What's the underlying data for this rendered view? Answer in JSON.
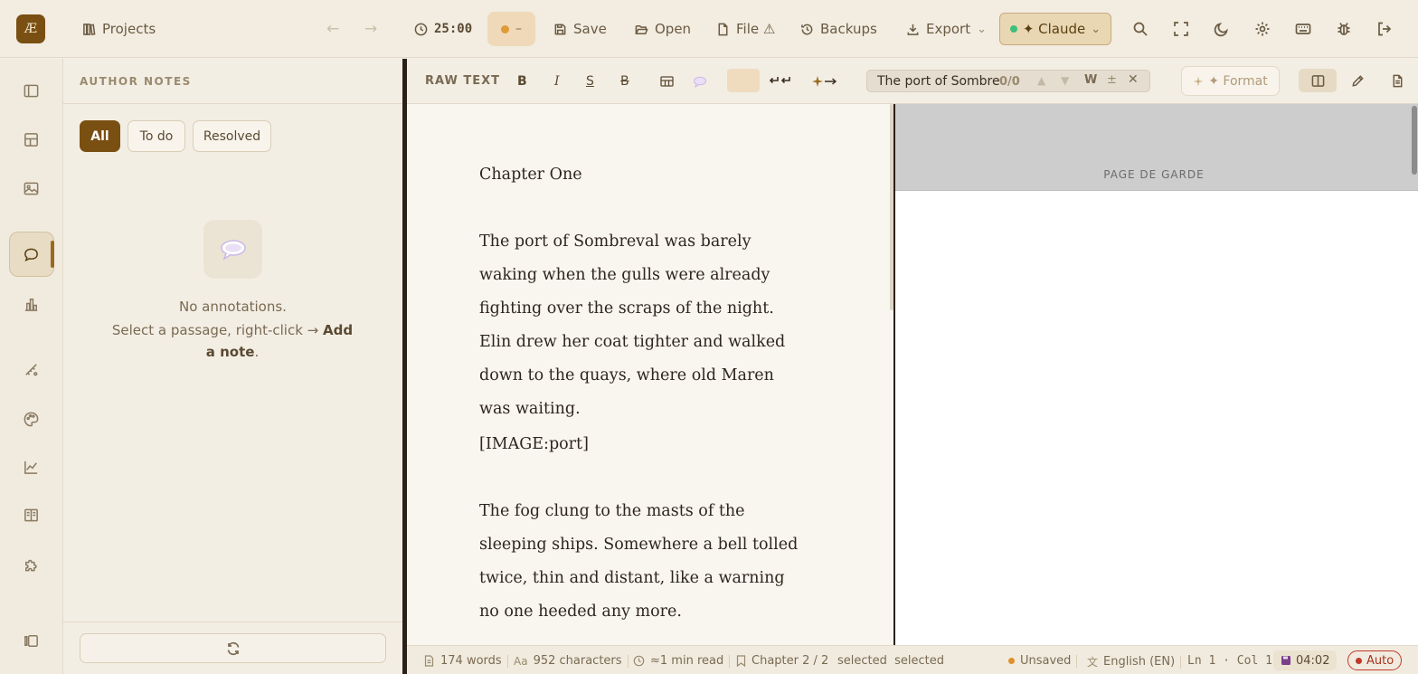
{
  "app": {
    "logo_text": "Æ"
  },
  "topbar": {
    "projects_label": "Projects",
    "back_arrow": "←",
    "forward_arrow": "→",
    "timer": "25:00",
    "pomodoro_state": "–",
    "save_label": "Save",
    "open_label": "Open",
    "file_label": "File ⚠",
    "backups_label": "Backups",
    "export_label": "Export",
    "export_caret": "⌄",
    "ai_provider_label": "✦ Claude",
    "ai_provider_caret": "⌄"
  },
  "sidebar": {
    "icons": [
      "panel-toggle-icon",
      "layout-icon",
      "image-icon",
      "comment-icon",
      "bar-chart-icon",
      "ruler-icon",
      "palette-icon",
      "line-chart-icon",
      "book-icon",
      "puzzle-icon",
      "collapse-icon"
    ],
    "active": "comment-icon"
  },
  "notes_panel": {
    "title": "AUTHOR NOTES",
    "filters": [
      "All",
      "To do",
      "Resolved"
    ],
    "active_filter": "All",
    "empty_title": "No annotations.",
    "empty_hint_prefix": "Select a passage, right-click → ",
    "empty_hint_bold": "Add a note",
    "empty_hint_suffix": "."
  },
  "editor_toolbar": {
    "mode_label": "RAW TEXT",
    "bold": "B",
    "italic": "I",
    "underline": "S",
    "strike": "B",
    "search_query": "The port of Sombre",
    "search_count": "0/0",
    "search_prev": "▲",
    "search_next": "▼",
    "search_whole_word": "W",
    "search_case": "±",
    "search_close": "✕",
    "format_label": "✦ Format"
  },
  "editor": {
    "paragraphs": [
      "Chapter One",
      "The port of Sombreval was barely waking when the gulls were already fighting over the scraps of the night. Elin drew her coat tighter and walked down to the quays, where old Maren was waiting.",
      "[IMAGE:port]",
      "The fog clung to the masts of the sleeping ships. Somewhere a bell tolled twice, thin and distant, like a warning no one heeded any more."
    ]
  },
  "preview": {
    "page_label": "PAGE DE GARDE"
  },
  "status": {
    "words": "174 words",
    "characters": "952 characters",
    "read_time": "≈1 min read",
    "chapter": "Chapter 2 / 2",
    "selection": "selected  selected",
    "save_state": "Unsaved",
    "language": "English (EN)",
    "cursor": "Ln 1 · Col 1",
    "save_time": "04:02",
    "autosave": "Auto"
  },
  "colors": {
    "accent": "#7a4f12",
    "unsaved_dot": "#e0902a",
    "auto_chip": "#c0392b",
    "claude_online": "#3cbf7a"
  }
}
